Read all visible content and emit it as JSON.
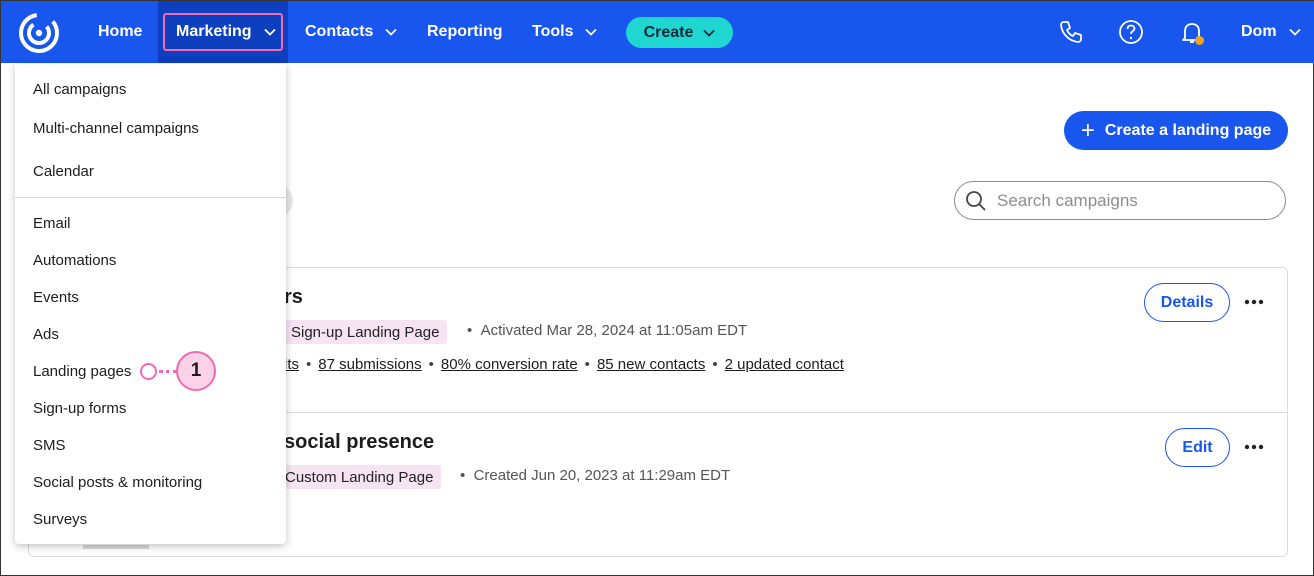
{
  "nav": {
    "home": "Home",
    "marketing": "Marketing",
    "contacts": "Contacts",
    "reporting": "Reporting",
    "tools": "Tools",
    "create": "Create",
    "user": "Dom",
    "icons": [
      "phone-icon",
      "help-icon",
      "bell-icon"
    ],
    "notification_dot_color": "#f7a21b"
  },
  "marketing_menu": {
    "group1": [
      "All campaigns",
      "Multi-channel campaigns",
      "Calendar"
    ],
    "group2": [
      "Email",
      "Automations",
      "Events",
      "Ads",
      "Landing pages",
      "Sign-up forms",
      "SMS",
      "Social posts & monitoring",
      "Surveys"
    ]
  },
  "callout": {
    "number": "1",
    "color": "#f06bb1"
  },
  "page": {
    "create_button": "Create a landing page",
    "search_placeholder": "Search campaigns"
  },
  "campaigns": [
    {
      "title_fragment": "rs",
      "type_tag": "Sign-up Landing Page",
      "status": "Activated Mar 28, 2024 at 11:05am EDT",
      "stats": [
        "its",
        "87 submissions",
        "80% conversion rate",
        "85 new contacts",
        "2 updated contact"
      ],
      "action": "Details"
    },
    {
      "title_fragment": "social presence",
      "type_tag": "Custom Landing Page",
      "status": "Created Jun 20, 2023 at 11:29am EDT",
      "action": "Edit"
    }
  ],
  "colors": {
    "brand_blue": "#1856ed",
    "create_teal": "#1fd6d0",
    "tag_pink": "#f7e4f3"
  }
}
